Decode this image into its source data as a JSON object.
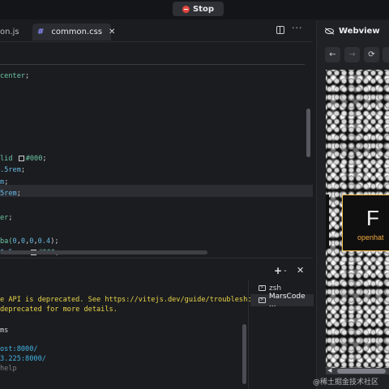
{
  "toolbar": {
    "stop_label": "Stop"
  },
  "editor": {
    "tabs": [
      {
        "label": "on.js"
      },
      {
        "label": "common.css",
        "icon": "hash-icon"
      }
    ],
    "code_lines": [
      {
        "parts": [
          {
            "t": "center",
            "c": "c-g"
          },
          {
            "t": ";",
            "c": "c-w"
          }
        ]
      },
      {
        "parts": [
          {
            "t": "lid ",
            "c": "c-g"
          },
          {
            "t": "#000",
            "c": "c-g"
          },
          {
            "t": ";",
            "c": "c-w"
          }
        ]
      },
      {
        "parts": [
          {
            "t": ".5rem",
            "c": "c-b"
          },
          {
            "t": ";",
            "c": "c-w"
          }
        ]
      },
      {
        "parts": [
          {
            "t": "m",
            "c": "c-b"
          },
          {
            "t": ";",
            "c": "c-w"
          }
        ]
      },
      {
        "parts": [
          {
            "t": "5rem",
            "c": "c-b"
          },
          {
            "t": ";",
            "c": "c-w"
          }
        ]
      },
      {
        "parts": [
          {
            "t": "er",
            "c": "c-g"
          },
          {
            "t": ";",
            "c": "c-w"
          }
        ]
      },
      {
        "parts": [
          {
            "t": "ba(",
            "c": "c-g"
          },
          {
            "t": "0",
            "c": "c-b"
          },
          {
            "t": ",",
            "c": "c-w"
          },
          {
            "t": "0",
            "c": "c-b"
          },
          {
            "t": ",",
            "c": "c-w"
          },
          {
            "t": "0",
            "c": "c-b"
          },
          {
            "t": ",",
            "c": "c-w"
          },
          {
            "t": "0.4",
            "c": "c-b"
          },
          {
            "t": ");",
            "c": "c-w"
          }
        ]
      },
      {
        "parts": [
          {
            "t": "0.5rem ",
            "c": "c-b"
          },
          {
            "t": "#000",
            "c": "c-g"
          },
          {
            "t": ";",
            "c": "c-w"
          }
        ]
      }
    ]
  },
  "terminal": {
    "lines": [
      {
        "text": "e API is deprecated. See https://vitejs.dev/guide/troubleshoot",
        "c": "t-y"
      },
      {
        "text": "deprecated for more details.",
        "c": "t-y"
      },
      {
        "text": "",
        "c": "t-w"
      },
      {
        "text": "ms",
        "c": "t-w"
      },
      {
        "text": "",
        "c": "t-w"
      },
      {
        "text": "ost:8000/",
        "c": "t-b"
      },
      {
        "text": "3.225:8000/",
        "c": "t-b"
      },
      {
        "text": "help",
        "c": "t-d"
      }
    ],
    "sessions": [
      {
        "label": "zsh",
        "active": false
      },
      {
        "label": "MarsCode ...",
        "active": true
      }
    ]
  },
  "webview": {
    "title": "Webview",
    "nav": {
      "back": "←",
      "forward": "→",
      "reload": "⟳"
    },
    "banner_letter": "F",
    "banner_text": "openhat"
  },
  "watermark": "@稀土掘金技术社区",
  "colors": {
    "stop_dot": "#e2473f",
    "banner_border": "#f2c14a",
    "banner_text": "#f2a93a",
    "link": "#43b3e4",
    "warning": "#e9d44a"
  }
}
